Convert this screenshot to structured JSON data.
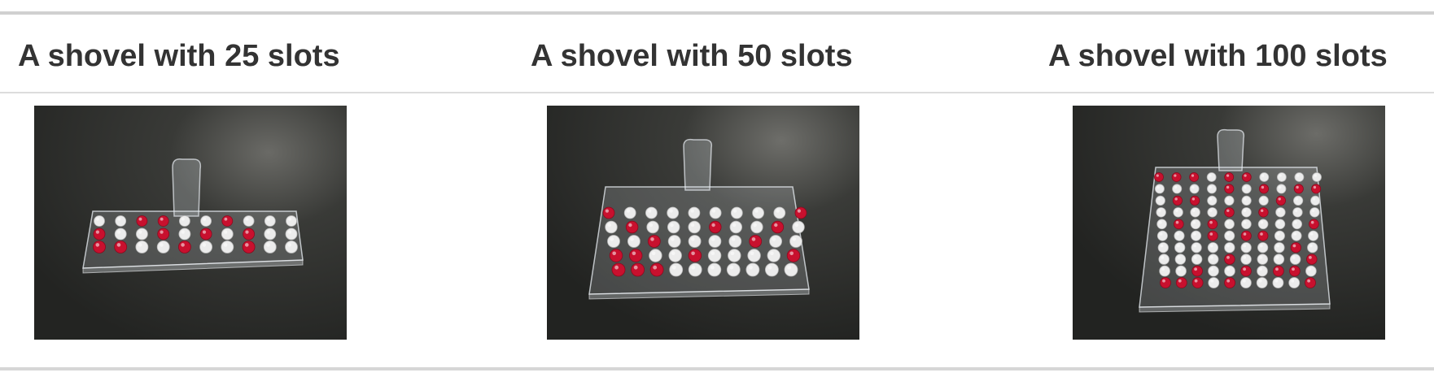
{
  "table": {
    "columns": [
      {
        "header": "A shovel with 25 slots",
        "image": {
          "rows": 3,
          "cols": 10
        }
      },
      {
        "header": "A shovel with 50 slots",
        "image": {
          "rows": 5,
          "cols": 10
        }
      },
      {
        "header": "A shovel with 100 slots",
        "image": {
          "rows": 10,
          "cols": 10
        }
      }
    ]
  },
  "colors": {
    "header_text": "#333333",
    "rule": "#d0d0d0",
    "photo_bg": "#2b2c2a",
    "ball_red": "#c8102e",
    "ball_white": "#ececec"
  }
}
